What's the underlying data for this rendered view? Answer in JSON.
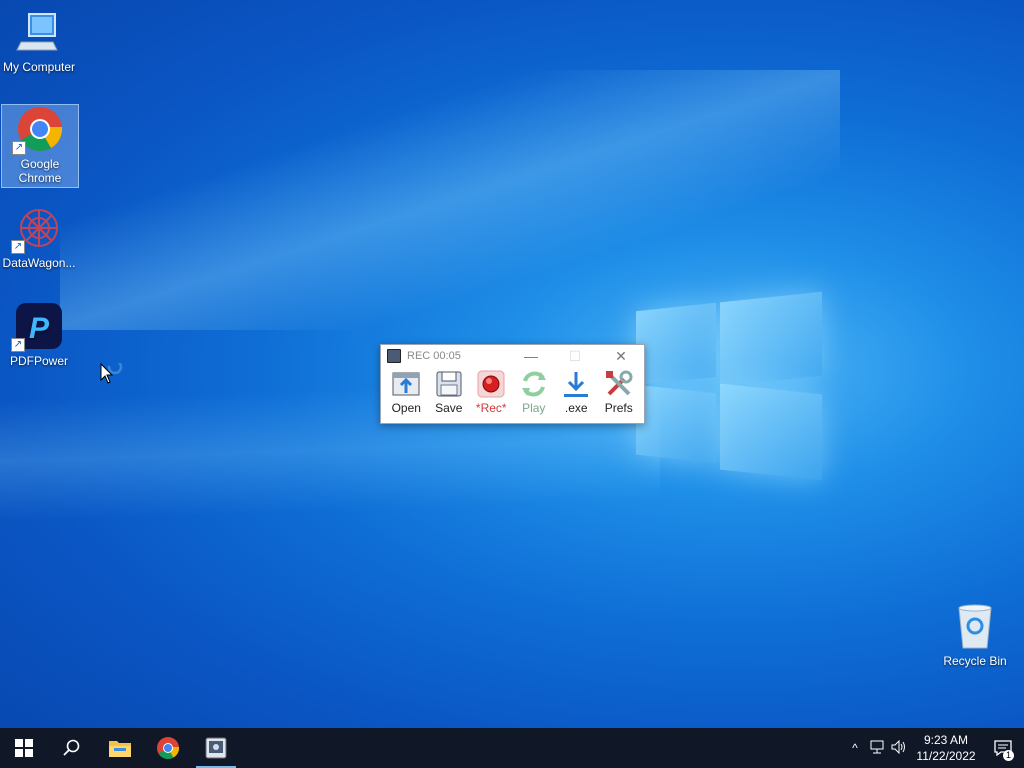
{
  "desktop": {
    "icons": [
      {
        "label": "My Computer",
        "icon": "computer-icon"
      },
      {
        "label": "Google Chrome",
        "icon": "chrome-icon"
      },
      {
        "label": "DataWagon...",
        "icon": "datawagon-icon"
      },
      {
        "label": "PDFPower",
        "icon": "pdfpower-icon"
      },
      {
        "label": "Recycle Bin",
        "icon": "recycle-bin-icon"
      }
    ]
  },
  "recorder": {
    "title": "REC 00:05",
    "tools": [
      {
        "label": "Open",
        "icon": "open-icon"
      },
      {
        "label": "Save",
        "icon": "save-icon"
      },
      {
        "label": "*Rec*",
        "icon": "record-icon"
      },
      {
        "label": "Play",
        "icon": "play-icon"
      },
      {
        "label": ".exe",
        "icon": "download-icon"
      },
      {
        "label": "Prefs",
        "icon": "prefs-icon"
      }
    ]
  },
  "taskbar": {
    "time": "9:23 AM",
    "date": "11/22/2022",
    "notification_count": "1"
  },
  "colors": {
    "taskbar_bg": "#101828",
    "rec_red": "#d23a3a"
  }
}
